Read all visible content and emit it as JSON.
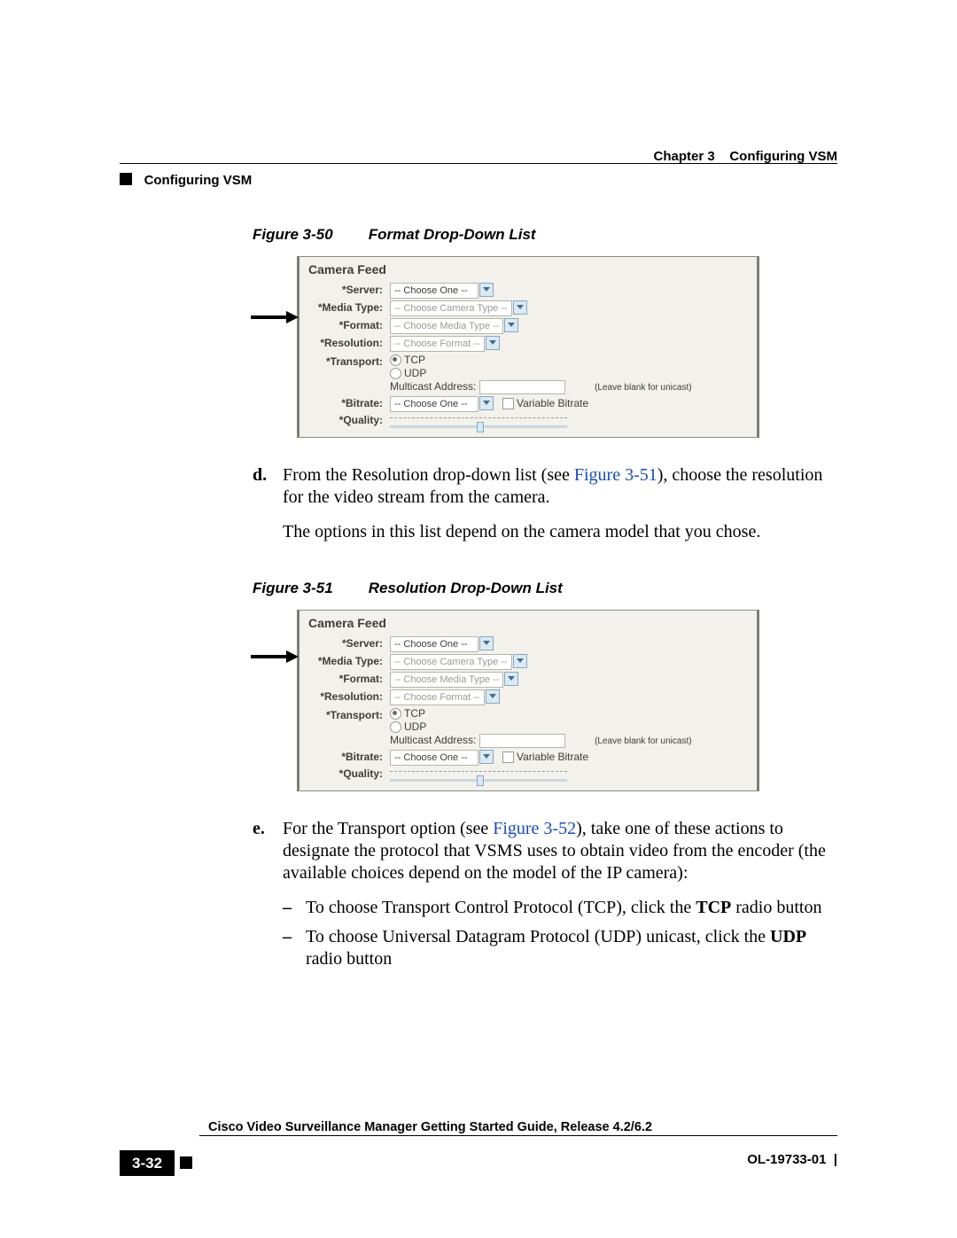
{
  "header": {
    "chapter": "Chapter 3",
    "title_right": "Configuring VSM",
    "section": "Configuring VSM"
  },
  "fig50": {
    "num": "Figure 3-50",
    "title": "Format Drop-Down List"
  },
  "fig51": {
    "num": "Figure 3-51",
    "title": "Resolution Drop-Down List"
  },
  "shot": {
    "title": "Camera Feed",
    "labels": {
      "server": "*Server:",
      "mediaType": "*Media Type:",
      "format": "*Format:",
      "resolution": "*Resolution:",
      "transport": "*Transport:",
      "bitrate": "*Bitrate:",
      "quality": "*Quality:"
    },
    "dd": {
      "chooseOne": "-- Choose One --",
      "chooseCamera": "-- Choose Camera Type --",
      "chooseMedia": "-- Choose Media Type --",
      "chooseFormat": "-- Choose Format --"
    },
    "transport": {
      "tcp": "TCP",
      "udp": "UDP",
      "multicast": "Multicast Address:",
      "note": "(Leave blank for unicast)"
    },
    "variableBitrate": "Variable Bitrate"
  },
  "steps": {
    "d": {
      "marker": "d.",
      "p1a": "From the Resolution drop-down list (see ",
      "p1link": "Figure 3-51",
      "p1b": "), choose the resolution for the video stream from the camera.",
      "p2": "The options in this list depend on the camera model that you chose."
    },
    "e": {
      "marker": "e.",
      "p1a": "For the Transport option (see ",
      "p1link": "Figure 3-52",
      "p1b": "), take one of these actions to designate the protocol that VSMS uses to obtain video from the encoder (the available choices depend on the model of the IP camera):",
      "b1a": "To choose Transport Control Protocol (TCP), click the ",
      "b1b": "TCP",
      "b1c": " radio button",
      "b2a": "To choose Universal Datagram Protocol (UDP) unicast, click the ",
      "b2b": "UDP",
      "b2c": " radio button"
    }
  },
  "footer": {
    "guide": "Cisco Video Surveillance Manager Getting Started Guide, Release 4.2/6.2",
    "pagenum": "3-32",
    "ol": "OL-19733-01"
  }
}
